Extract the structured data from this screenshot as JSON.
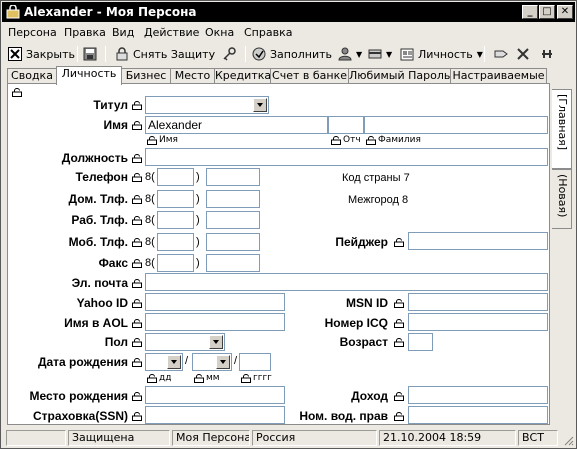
{
  "window": {
    "title": "Alexander - Моя Персона"
  },
  "menu": [
    "Персона",
    "Правка",
    "Вид",
    "Действие",
    "Окна",
    "Справка"
  ],
  "toolbar": {
    "close_label": "Закрыть",
    "unlock_label": "Снять Защиту",
    "fill_label": "Заполнить",
    "persona_label": "Личность"
  },
  "tabs": [
    "Сводка",
    "Личность",
    "Бизнес",
    "Место",
    "Кредитка",
    "Счет в банке",
    "Любимый Пароль",
    "Настраиваемые"
  ],
  "active_tab": "Личность",
  "side_tabs": [
    "[Главная]",
    "(Новая)"
  ],
  "form": {
    "title_label": "Титул",
    "name_label": "Имя",
    "name_value": "Alexander",
    "first_sub": "Имя",
    "middle_sub": "Отч",
    "last_sub": "Фамилия",
    "position_label": "Должность",
    "phone_label": "Телефон",
    "home_phone_label": "Дом. Тлф.",
    "work_phone_label": "Раб. Тлф.",
    "mobile_label": "Моб. Тлф.",
    "fax_label": "Факс",
    "phone_prefix": "8(",
    "phone_close": ")",
    "country_code": "Код страны 7",
    "intercity_code": "Межгород 8",
    "pager_label": "Пейджер",
    "email_label": "Эл. почта",
    "yahoo_label": "Yahoo ID",
    "msn_label": "MSN ID",
    "aol_label": "Имя в AOL",
    "icq_label": "Номер ICQ",
    "sex_label": "Пол",
    "age_label": "Возраст",
    "birthdate_label": "Дата рождения",
    "date_sep": "/",
    "dd_label": "дд",
    "mm_label": "мм",
    "yyyy_label": "гггг",
    "birthplace_label": "Место рождения",
    "income_label": "Доход",
    "ssn_label": "Страховка(SSN)",
    "license_label": "Ном. вод. прав"
  },
  "status": {
    "protected": "Защищена",
    "persona": "Моя Персона",
    "country": "Россия",
    "datetime": "21.10.2004 18:59",
    "mode": "ВСТ"
  }
}
